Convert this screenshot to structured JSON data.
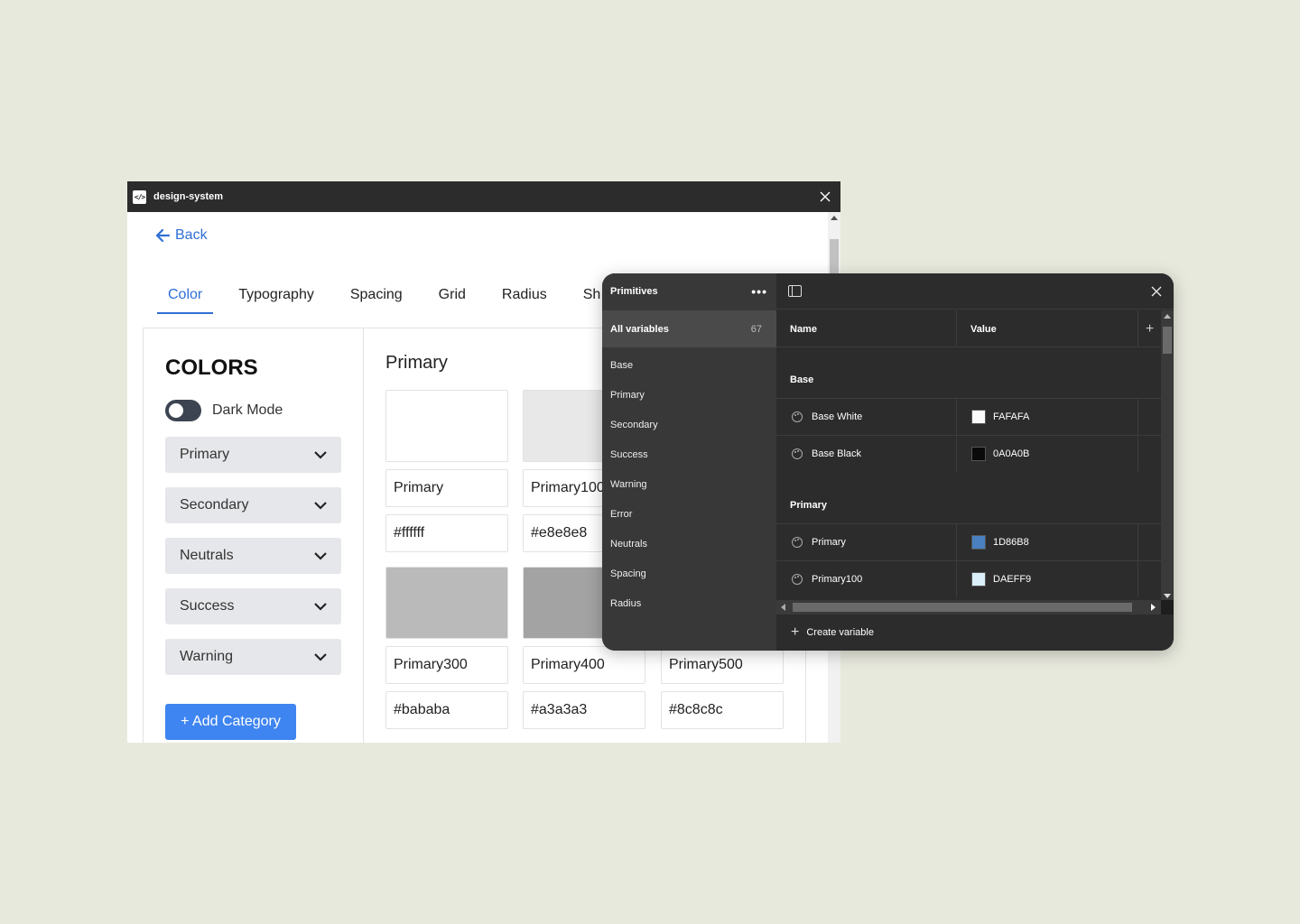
{
  "plugin": {
    "title": "design-system",
    "back_label": "Back",
    "tabs": [
      "Color",
      "Typography",
      "Spacing",
      "Grid",
      "Radius",
      "Sh"
    ],
    "colors_heading": "COLORS",
    "dark_mode_label": "Dark Mode",
    "dark_mode_on": false,
    "categories": [
      "Primary",
      "Secondary",
      "Neutrals",
      "Success",
      "Warning"
    ],
    "add_category_label": "+ Add Category",
    "group_heading": "Primary",
    "swatches": [
      {
        "name": "Primary",
        "hex": "#ffffff",
        "color": "#ffffff"
      },
      {
        "name": "Primary100",
        "hex": "#e8e8e8",
        "color": "#e8e8e8"
      },
      {
        "name": "Primary300",
        "hex": "#bababa",
        "color": "#bababa"
      },
      {
        "name": "Primary400",
        "hex": "#a3a3a3",
        "color": "#a3a3a3"
      },
      {
        "name": "Primary500",
        "hex": "#8c8c8c",
        "color": "#8c8c8c"
      }
    ],
    "accent_color": "#3f85f1"
  },
  "variables": {
    "collection": "Primitives",
    "all_variables_label": "All variables",
    "all_variables_count": "67",
    "groups": [
      "Base",
      "Primary",
      "Secondary",
      "Success",
      "Warning",
      "Error",
      "Neutrals",
      "Spacing",
      "Radius"
    ],
    "columns": {
      "name": "Name",
      "value": "Value"
    },
    "sections": [
      {
        "label": "Base",
        "rows": [
          {
            "name": "Base White",
            "value": "FAFAFA",
            "color": "#fafafa"
          },
          {
            "name": "Base Black",
            "value": "0A0A0B",
            "color": "#0a0a0b"
          }
        ]
      },
      {
        "label": "Primary",
        "rows": [
          {
            "name": "Primary",
            "value": "1D86B8",
            "color": "#4a7fc0"
          },
          {
            "name": "Primary100",
            "value": "DAEFF9",
            "color": "#daeff9"
          }
        ]
      }
    ],
    "create_label": "Create variable"
  }
}
